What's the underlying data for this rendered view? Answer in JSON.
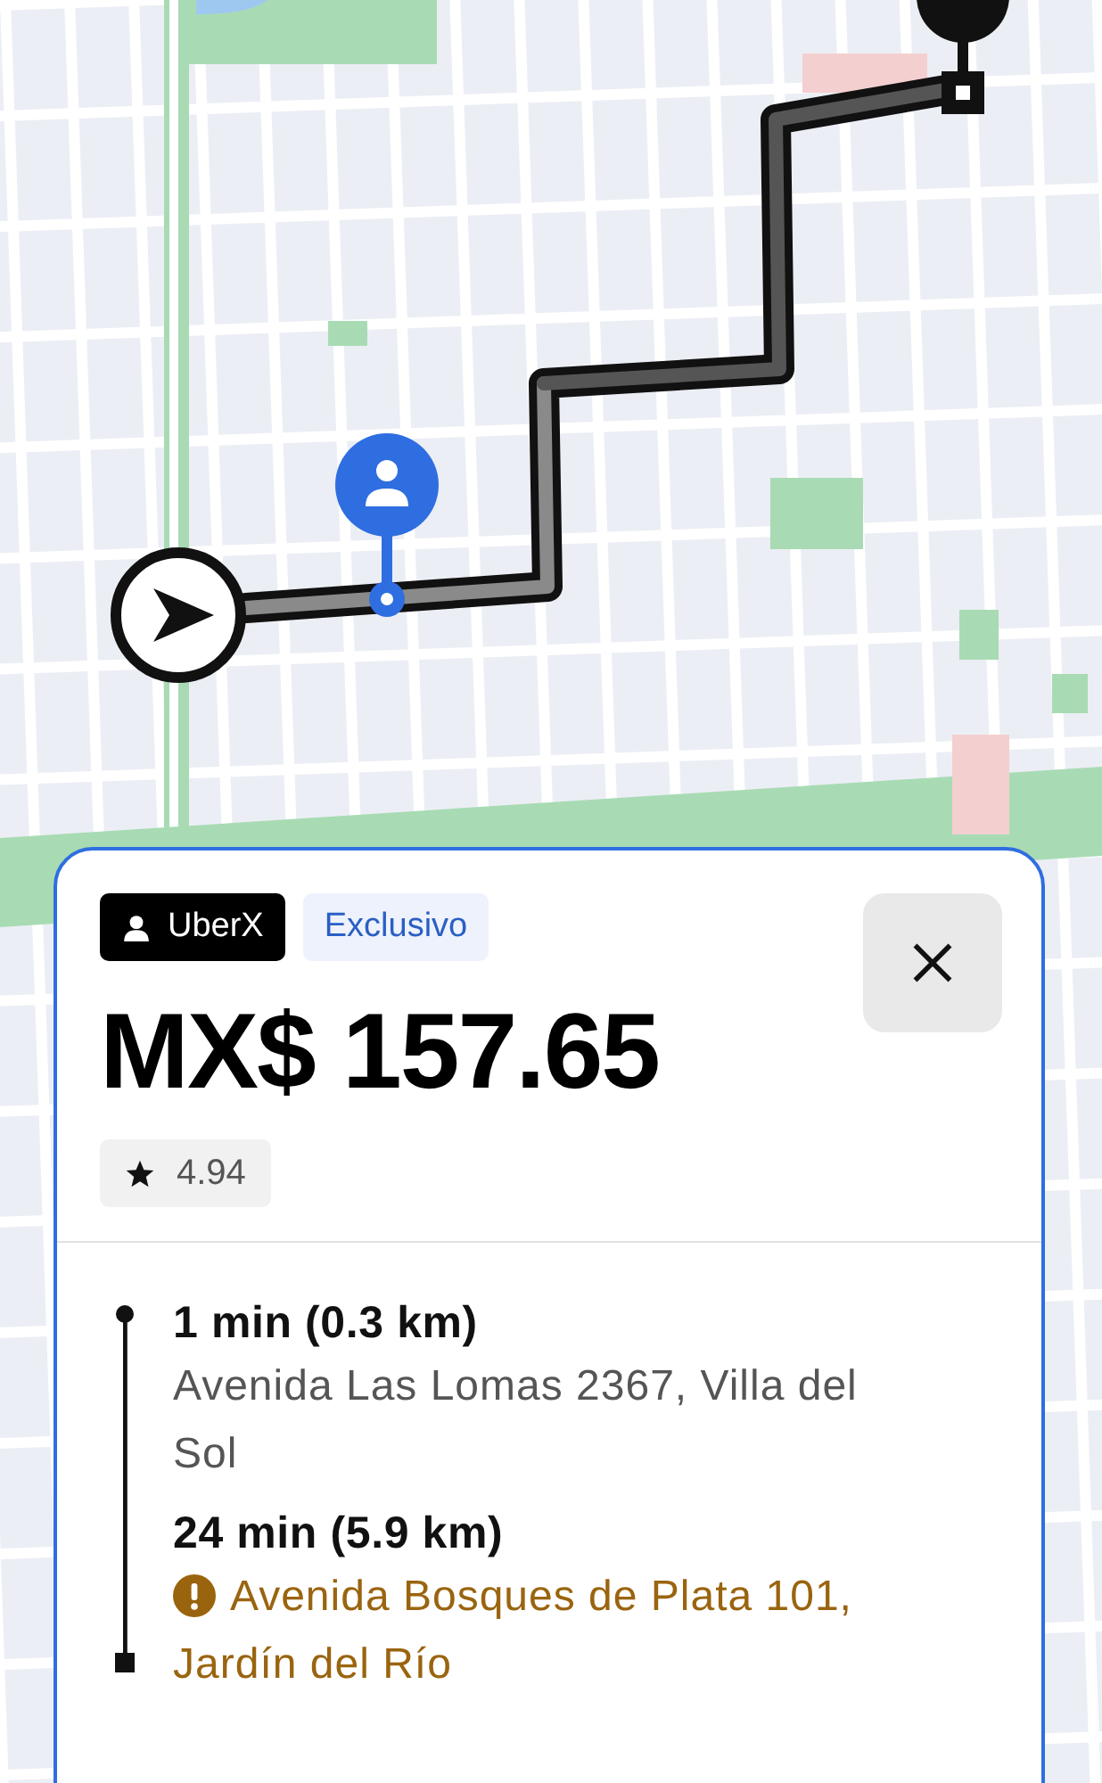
{
  "ride": {
    "product": "UberX",
    "tag": "Exclusivo",
    "price": "MX$ 157.65",
    "rating": "4.94"
  },
  "stops": [
    {
      "time": "1 min (0.3 km)",
      "address": "Avenida Las Lomas 2367, Villa del Sol",
      "warning": false
    },
    {
      "time": "24 min (5.9 km)",
      "address": "Avenida Bosques de Plata 101, Jardín del Río",
      "warning": true
    }
  ]
}
